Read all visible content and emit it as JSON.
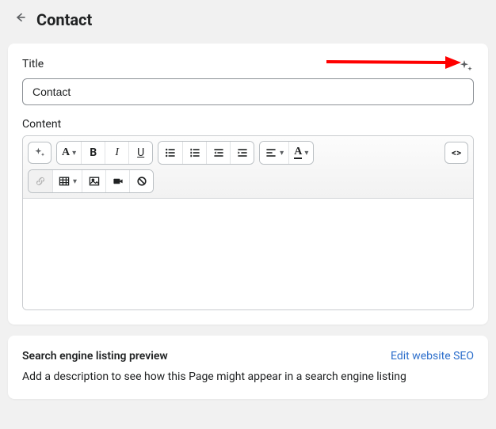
{
  "header": {
    "page_title": "Contact"
  },
  "form": {
    "title_label": "Title",
    "title_value": "Contact",
    "content_label": "Content"
  },
  "toolbar": {
    "heading_letter": "A",
    "bold": "B",
    "italic": "I",
    "underline": "U",
    "fontcolor_letter": "A",
    "code_label": "<>"
  },
  "seo": {
    "heading": "Search engine listing preview",
    "edit_link": "Edit website SEO",
    "description": "Add a description to see how this Page might appear in a search engine listing"
  }
}
